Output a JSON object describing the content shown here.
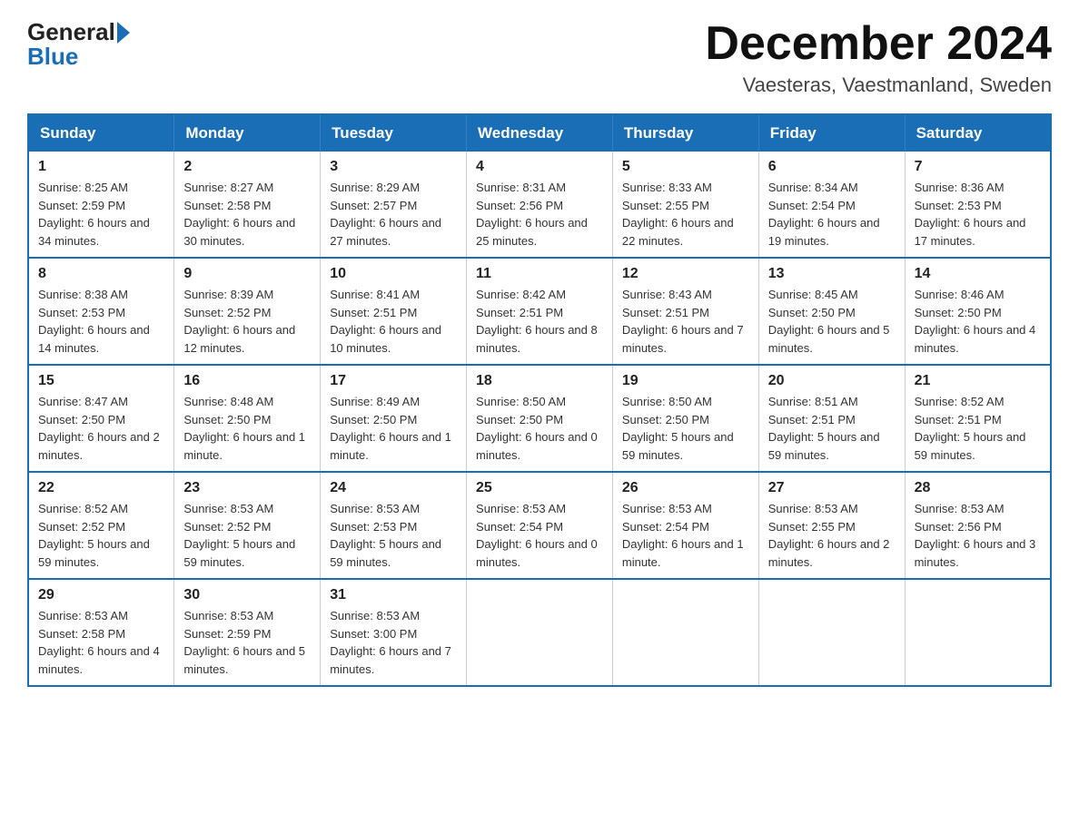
{
  "header": {
    "logo_general": "General",
    "logo_blue": "Blue",
    "main_title": "December 2024",
    "subtitle": "Vaesteras, Vaestmanland, Sweden"
  },
  "calendar": {
    "days_of_week": [
      "Sunday",
      "Monday",
      "Tuesday",
      "Wednesday",
      "Thursday",
      "Friday",
      "Saturday"
    ],
    "weeks": [
      [
        {
          "day": "1",
          "sunrise": "Sunrise: 8:25 AM",
          "sunset": "Sunset: 2:59 PM",
          "daylight": "Daylight: 6 hours and 34 minutes."
        },
        {
          "day": "2",
          "sunrise": "Sunrise: 8:27 AM",
          "sunset": "Sunset: 2:58 PM",
          "daylight": "Daylight: 6 hours and 30 minutes."
        },
        {
          "day": "3",
          "sunrise": "Sunrise: 8:29 AM",
          "sunset": "Sunset: 2:57 PM",
          "daylight": "Daylight: 6 hours and 27 minutes."
        },
        {
          "day": "4",
          "sunrise": "Sunrise: 8:31 AM",
          "sunset": "Sunset: 2:56 PM",
          "daylight": "Daylight: 6 hours and 25 minutes."
        },
        {
          "day": "5",
          "sunrise": "Sunrise: 8:33 AM",
          "sunset": "Sunset: 2:55 PM",
          "daylight": "Daylight: 6 hours and 22 minutes."
        },
        {
          "day": "6",
          "sunrise": "Sunrise: 8:34 AM",
          "sunset": "Sunset: 2:54 PM",
          "daylight": "Daylight: 6 hours and 19 minutes."
        },
        {
          "day": "7",
          "sunrise": "Sunrise: 8:36 AM",
          "sunset": "Sunset: 2:53 PM",
          "daylight": "Daylight: 6 hours and 17 minutes."
        }
      ],
      [
        {
          "day": "8",
          "sunrise": "Sunrise: 8:38 AM",
          "sunset": "Sunset: 2:53 PM",
          "daylight": "Daylight: 6 hours and 14 minutes."
        },
        {
          "day": "9",
          "sunrise": "Sunrise: 8:39 AM",
          "sunset": "Sunset: 2:52 PM",
          "daylight": "Daylight: 6 hours and 12 minutes."
        },
        {
          "day": "10",
          "sunrise": "Sunrise: 8:41 AM",
          "sunset": "Sunset: 2:51 PM",
          "daylight": "Daylight: 6 hours and 10 minutes."
        },
        {
          "day": "11",
          "sunrise": "Sunrise: 8:42 AM",
          "sunset": "Sunset: 2:51 PM",
          "daylight": "Daylight: 6 hours and 8 minutes."
        },
        {
          "day": "12",
          "sunrise": "Sunrise: 8:43 AM",
          "sunset": "Sunset: 2:51 PM",
          "daylight": "Daylight: 6 hours and 7 minutes."
        },
        {
          "day": "13",
          "sunrise": "Sunrise: 8:45 AM",
          "sunset": "Sunset: 2:50 PM",
          "daylight": "Daylight: 6 hours and 5 minutes."
        },
        {
          "day": "14",
          "sunrise": "Sunrise: 8:46 AM",
          "sunset": "Sunset: 2:50 PM",
          "daylight": "Daylight: 6 hours and 4 minutes."
        }
      ],
      [
        {
          "day": "15",
          "sunrise": "Sunrise: 8:47 AM",
          "sunset": "Sunset: 2:50 PM",
          "daylight": "Daylight: 6 hours and 2 minutes."
        },
        {
          "day": "16",
          "sunrise": "Sunrise: 8:48 AM",
          "sunset": "Sunset: 2:50 PM",
          "daylight": "Daylight: 6 hours and 1 minute."
        },
        {
          "day": "17",
          "sunrise": "Sunrise: 8:49 AM",
          "sunset": "Sunset: 2:50 PM",
          "daylight": "Daylight: 6 hours and 1 minute."
        },
        {
          "day": "18",
          "sunrise": "Sunrise: 8:50 AM",
          "sunset": "Sunset: 2:50 PM",
          "daylight": "Daylight: 6 hours and 0 minutes."
        },
        {
          "day": "19",
          "sunrise": "Sunrise: 8:50 AM",
          "sunset": "Sunset: 2:50 PM",
          "daylight": "Daylight: 5 hours and 59 minutes."
        },
        {
          "day": "20",
          "sunrise": "Sunrise: 8:51 AM",
          "sunset": "Sunset: 2:51 PM",
          "daylight": "Daylight: 5 hours and 59 minutes."
        },
        {
          "day": "21",
          "sunrise": "Sunrise: 8:52 AM",
          "sunset": "Sunset: 2:51 PM",
          "daylight": "Daylight: 5 hours and 59 minutes."
        }
      ],
      [
        {
          "day": "22",
          "sunrise": "Sunrise: 8:52 AM",
          "sunset": "Sunset: 2:52 PM",
          "daylight": "Daylight: 5 hours and 59 minutes."
        },
        {
          "day": "23",
          "sunrise": "Sunrise: 8:53 AM",
          "sunset": "Sunset: 2:52 PM",
          "daylight": "Daylight: 5 hours and 59 minutes."
        },
        {
          "day": "24",
          "sunrise": "Sunrise: 8:53 AM",
          "sunset": "Sunset: 2:53 PM",
          "daylight": "Daylight: 5 hours and 59 minutes."
        },
        {
          "day": "25",
          "sunrise": "Sunrise: 8:53 AM",
          "sunset": "Sunset: 2:54 PM",
          "daylight": "Daylight: 6 hours and 0 minutes."
        },
        {
          "day": "26",
          "sunrise": "Sunrise: 8:53 AM",
          "sunset": "Sunset: 2:54 PM",
          "daylight": "Daylight: 6 hours and 1 minute."
        },
        {
          "day": "27",
          "sunrise": "Sunrise: 8:53 AM",
          "sunset": "Sunset: 2:55 PM",
          "daylight": "Daylight: 6 hours and 2 minutes."
        },
        {
          "day": "28",
          "sunrise": "Sunrise: 8:53 AM",
          "sunset": "Sunset: 2:56 PM",
          "daylight": "Daylight: 6 hours and 3 minutes."
        }
      ],
      [
        {
          "day": "29",
          "sunrise": "Sunrise: 8:53 AM",
          "sunset": "Sunset: 2:58 PM",
          "daylight": "Daylight: 6 hours and 4 minutes."
        },
        {
          "day": "30",
          "sunrise": "Sunrise: 8:53 AM",
          "sunset": "Sunset: 2:59 PM",
          "daylight": "Daylight: 6 hours and 5 minutes."
        },
        {
          "day": "31",
          "sunrise": "Sunrise: 8:53 AM",
          "sunset": "Sunset: 3:00 PM",
          "daylight": "Daylight: 6 hours and 7 minutes."
        },
        null,
        null,
        null,
        null
      ]
    ]
  }
}
